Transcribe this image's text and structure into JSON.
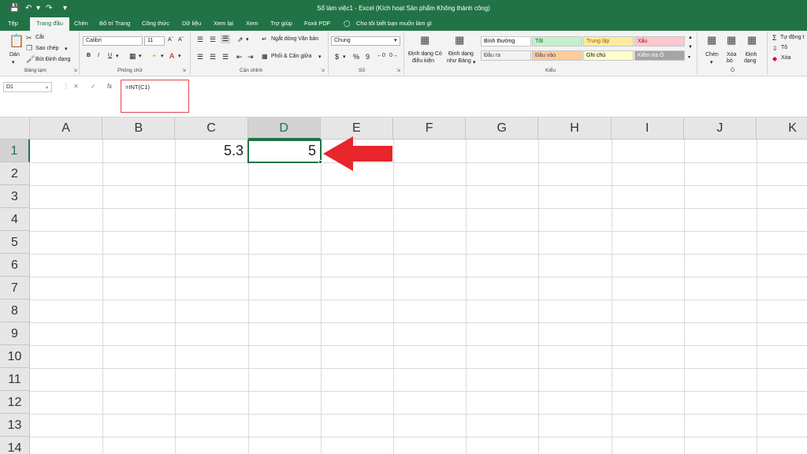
{
  "window": {
    "title": "Sổ làm việc1  -  Excel (Kích hoạt Sản phẩm Không thành công)"
  },
  "tabs": [
    {
      "label": "Tệp",
      "active": false
    },
    {
      "label": "Trang đầu",
      "active": true
    },
    {
      "label": "Chèn",
      "active": false
    },
    {
      "label": "Bố trí Trang",
      "active": false
    },
    {
      "label": "Công thức",
      "active": false
    },
    {
      "label": "Dữ liệu",
      "active": false
    },
    {
      "label": "Xem lại",
      "active": false
    },
    {
      "label": "Xem",
      "active": false
    },
    {
      "label": "Trợ giúp",
      "active": false
    },
    {
      "label": "Foxit PDF",
      "active": false
    }
  ],
  "tell_me": "Cho tôi biết bạn muốn làm gì",
  "ribbon": {
    "clipboard": {
      "paste": "Dán",
      "cut": "Cắt",
      "copy": "Sao chép",
      "format_painter": "Bút Định dạng",
      "group": "Bảng tạm"
    },
    "font": {
      "name": "Calibri",
      "size": "11",
      "bold": "B",
      "italic": "I",
      "underline": "U",
      "group": "Phông chữ"
    },
    "alignment": {
      "wrap": "Ngắt dòng Văn bản",
      "merge": "Phối & Căn giữa",
      "group": "Căn chỉnh"
    },
    "number": {
      "format": "Chung",
      "currency": "$",
      "percent": "%",
      "comma": "9",
      "group": "Số"
    },
    "styles": {
      "conditional": [
        "Định dạng Có",
        "điều kiện"
      ],
      "as_table": [
        "Định dạng",
        "như Bảng"
      ],
      "cells": [
        {
          "label": "Bình thường",
          "bg": "#ffffff",
          "fg": "#000000"
        },
        {
          "label": "Tốt",
          "bg": "#c6efce",
          "fg": "#006100"
        },
        {
          "label": "Trung lập",
          "bg": "#ffeb9c",
          "fg": "#9c5700"
        },
        {
          "label": "Xấu",
          "bg": "#ffc7ce",
          "fg": "#9c0006"
        },
        {
          "label": "Đầu ra",
          "bg": "#f2f2f2",
          "fg": "#3f3f3f"
        },
        {
          "label": "Đầu vào",
          "bg": "#ffcc99",
          "fg": "#3f3f76"
        },
        {
          "label": "Ghi chú",
          "bg": "#ffffcc",
          "fg": "#000000"
        },
        {
          "label": "Kiểm tra Ô",
          "bg": "#a5a5a5",
          "fg": "#ffffff"
        }
      ],
      "group": "Kiểu"
    },
    "cells": {
      "insert": "Chèn",
      "delete": [
        "Xóa",
        "bỏ"
      ],
      "format": [
        "Định",
        "dạng"
      ],
      "group": "Ô"
    },
    "editing": {
      "autosum": "Tự động t",
      "fill": "Tô",
      "clear": "Xóa"
    }
  },
  "formula_bar": {
    "name_box": "D1",
    "cancel": "✕",
    "enter": "✓",
    "fx": "fx",
    "formula": "=INT(C1)"
  },
  "grid": {
    "columns": [
      "A",
      "B",
      "C",
      "D",
      "E",
      "F",
      "G",
      "H",
      "I",
      "J",
      "K"
    ],
    "rows": [
      "1",
      "2",
      "3",
      "4",
      "5",
      "6",
      "7",
      "8",
      "9",
      "10",
      "11",
      "12",
      "13",
      "14"
    ],
    "selected_column": "D",
    "selected_row": "1",
    "cells": {
      "C1": "5.3",
      "D1": "5"
    }
  },
  "annotation": {
    "arrow_color": "#e8262b",
    "highlight_color": "#e0474c"
  }
}
